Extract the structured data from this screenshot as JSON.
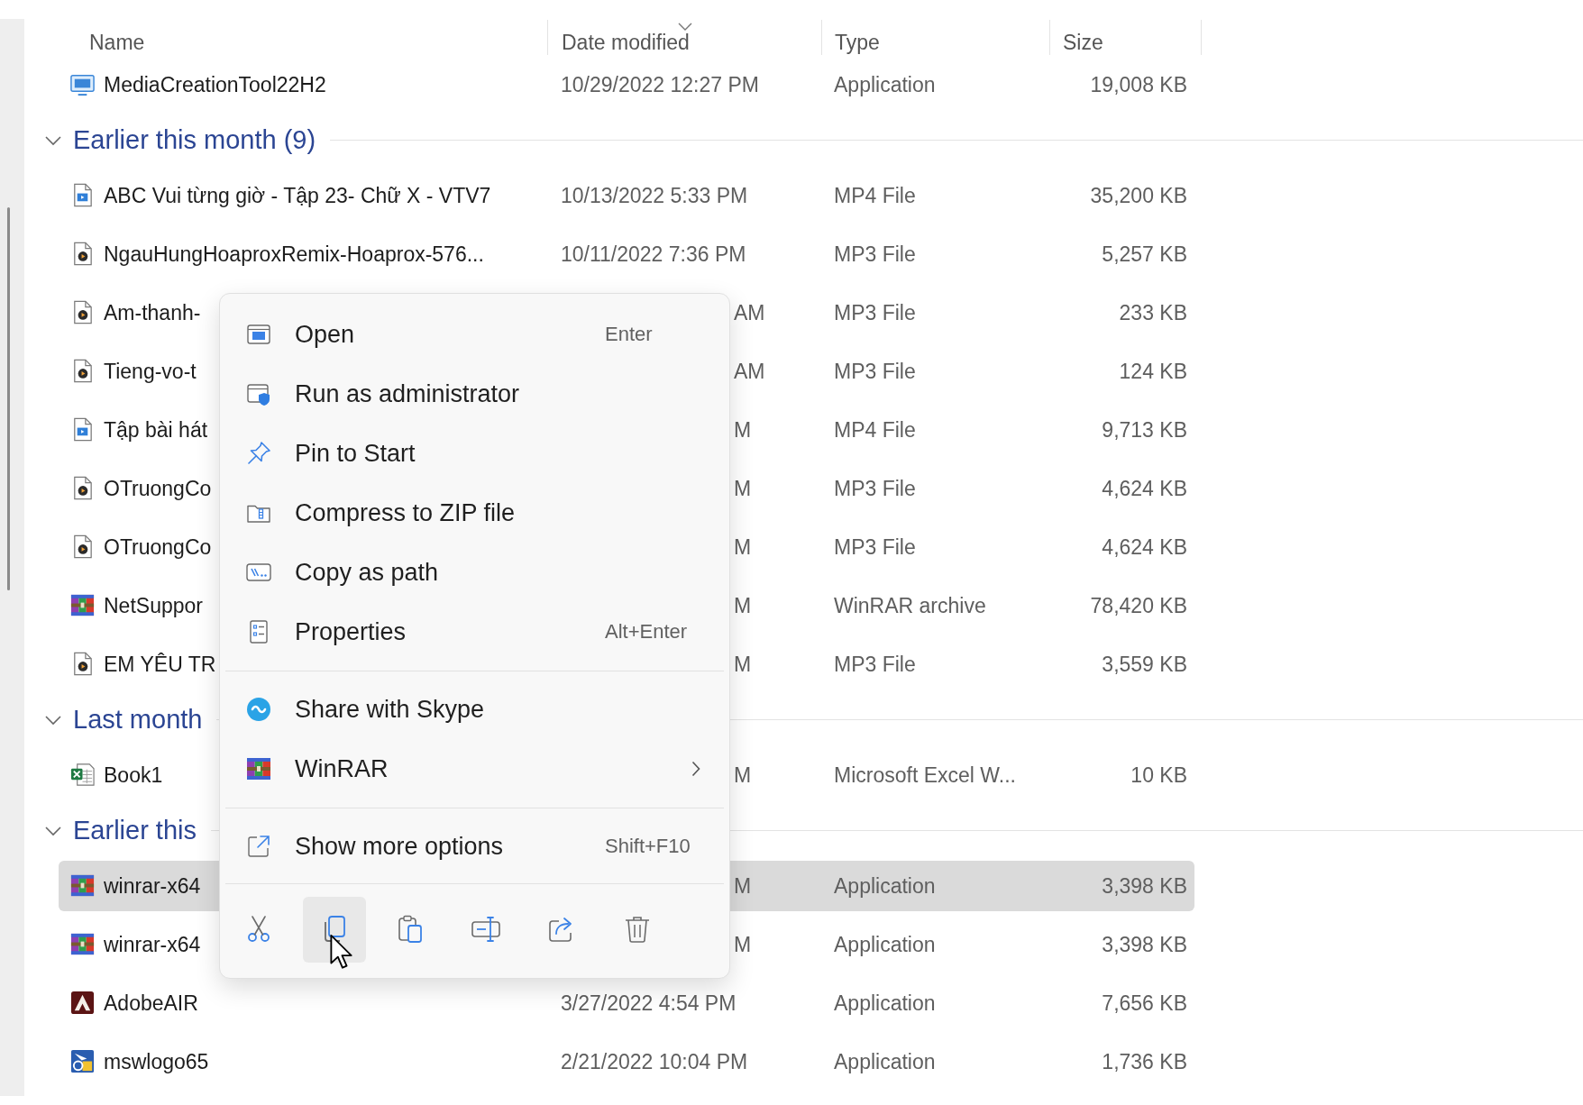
{
  "columns": [
    {
      "label": "Name",
      "sorted": false
    },
    {
      "label": "Date modified",
      "sorted": true
    },
    {
      "label": "Type",
      "sorted": false
    },
    {
      "label": "Size",
      "sorted": false
    }
  ],
  "top_rows": [
    {
      "kind": "setup",
      "name": "MediaCreationTool22H2",
      "date": "10/29/2022 12:27 PM",
      "type": "Application",
      "size": "19,008 KB",
      "selected": false
    }
  ],
  "groups": [
    {
      "label": "Earlier this month (9)",
      "expanded": true,
      "files": [
        {
          "kind": "video",
          "name": "ABC Vui từng giờ - Tập 23- Chữ X - VTV7",
          "date": "10/13/2022 5:33 PM",
          "type": "MP4 File",
          "size": "35,200 KB",
          "selected": false
        },
        {
          "kind": "audio",
          "name": "NgauHungHoaproxRemix-Hoaprox-576...",
          "date": "10/11/2022 7:36 PM",
          "type": "MP3 File",
          "size": "5,257 KB",
          "selected": false
        },
        {
          "kind": "audio",
          "name": "Am-thanh-",
          "date": "AM",
          "type": "MP3 File",
          "size": "233 KB",
          "selected": false
        },
        {
          "kind": "audio",
          "name": "Tieng-vo-t",
          "date": "AM",
          "type": "MP3 File",
          "size": "124 KB",
          "selected": false
        },
        {
          "kind": "video",
          "name": "Tập bài hát",
          "date": "M",
          "type": "MP4 File",
          "size": "9,713 KB",
          "selected": false
        },
        {
          "kind": "audio",
          "name": "OTruongCo",
          "date": "M",
          "type": "MP3 File",
          "size": "4,624 KB",
          "selected": false
        },
        {
          "kind": "audio",
          "name": "OTruongCo",
          "date": "M",
          "type": "MP3 File",
          "size": "4,624 KB",
          "selected": false
        },
        {
          "kind": "archive",
          "name": "NetSuppor",
          "date": "M",
          "type": "WinRAR archive",
          "size": "78,420 KB",
          "selected": false
        },
        {
          "kind": "audio",
          "name": "EM YÊU TR",
          "date": "M",
          "type": "MP3 File",
          "size": "3,559 KB",
          "selected": false
        }
      ]
    },
    {
      "label": "Last month",
      "expanded": true,
      "files": [
        {
          "kind": "sheet",
          "name": "Book1",
          "date": "M",
          "type": "Microsoft Excel W...",
          "size": "10 KB",
          "selected": false
        }
      ]
    },
    {
      "label": "Earlier this",
      "expanded": true,
      "files": [
        {
          "kind": "archive",
          "name": "winrar-x64",
          "date": "M",
          "type": "Application",
          "size": "3,398 KB",
          "selected": true
        },
        {
          "kind": "archive",
          "name": "winrar-x64",
          "date": "M",
          "type": "Application",
          "size": "3,398 KB",
          "selected": false
        },
        {
          "kind": "runtime",
          "name": "AdobeAIR",
          "date": "3/27/2022 4:54 PM",
          "type": "Application",
          "size": "7,656 KB",
          "selected": false
        },
        {
          "kind": "program",
          "name": "mswlogo65",
          "date": "2/21/2022 10:04 PM",
          "type": "Application",
          "size": "1,736 KB",
          "selected": false
        }
      ]
    }
  ],
  "context_menu": {
    "sections": [
      {
        "items": [
          {
            "kind": "open",
            "label": "Open",
            "shortcut": "Enter",
            "submenu": false
          },
          {
            "kind": "admin",
            "label": "Run as administrator",
            "submenu": false
          },
          {
            "kind": "pin",
            "label": "Pin to Start",
            "submenu": false
          },
          {
            "kind": "zip",
            "label": "Compress to ZIP file",
            "submenu": false
          },
          {
            "kind": "path",
            "label": "Copy as path",
            "submenu": false
          },
          {
            "kind": "properties",
            "label": "Properties",
            "shortcut": "Alt+Enter",
            "submenu": false
          }
        ]
      },
      {
        "items": [
          {
            "kind": "share",
            "label": "Share with Skype",
            "submenu": false
          },
          {
            "kind": "archive",
            "label": "WinRAR",
            "submenu": true
          }
        ]
      },
      {
        "items": [
          {
            "kind": "more",
            "label": "Show more options",
            "shortcut": "Shift+F10",
            "submenu": false
          }
        ]
      }
    ],
    "toolbar": [
      {
        "kind": "cut",
        "hovered": false
      },
      {
        "kind": "copy",
        "hovered": true
      },
      {
        "kind": "paste",
        "hovered": false
      },
      {
        "kind": "rename",
        "hovered": false
      },
      {
        "kind": "share",
        "hovered": false
      },
      {
        "kind": "delete",
        "hovered": false
      }
    ]
  }
}
